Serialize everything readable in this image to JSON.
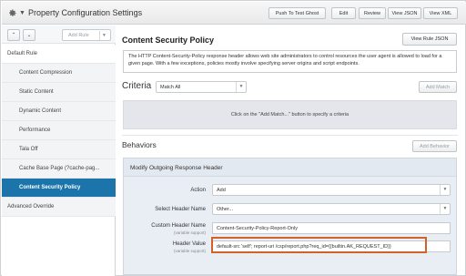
{
  "header": {
    "title": "Property Configuration Settings",
    "buttons": [
      "Push To Test Ghost",
      "Edit",
      "Review",
      "View JSON",
      "View XML"
    ]
  },
  "sidebar": {
    "add_rule_label": "Add Rule",
    "items": [
      {
        "label": "Default Rule"
      },
      {
        "label": "Content Compression"
      },
      {
        "label": "Static Content"
      },
      {
        "label": "Dynamic Content"
      },
      {
        "label": "Performance"
      },
      {
        "label": "Tala Off"
      },
      {
        "label": "Cache Base Page (?cache-pag..."
      },
      {
        "label": "Content Security Policy"
      },
      {
        "label": "Advanced Override"
      }
    ],
    "active_index": 7
  },
  "rule": {
    "title": "Content Security Policy",
    "view_json_label": "View Rule JSON",
    "description": "The HTTP Content-Security-Policy response header allows web site administrators to control resources the user agent is allowed to load for a given page. With a few exceptions, policies mostly involve specifying server origins and script endpoints."
  },
  "criteria": {
    "label": "Criteria",
    "match_value": "Match All",
    "add_match_label": "Add Match",
    "empty_text": "Click on the \"Add Match...\" button to specify a criteria"
  },
  "behaviors": {
    "label": "Behaviors",
    "add_behavior_label": "Add Behavior",
    "card_title": "Modify Outgoing Response Header",
    "fields": {
      "action": {
        "label": "Action",
        "value": "Add"
      },
      "select_header": {
        "label": "Select Header Name",
        "value": "Other..."
      },
      "custom_header": {
        "label": "Custom Header Name",
        "sublabel": "(variable support)",
        "value": "Content-Security-Policy-Report-Only"
      },
      "header_value": {
        "label": "Header Value",
        "sublabel": "(variable support)",
        "value": "default-src 'self'; report-uri /csp/report.php?req_id={{builtin.AK_REQUEST_ID}}"
      }
    }
  },
  "colors": {
    "active_item": "#1b75ab",
    "highlight_border": "#d2622a",
    "criteria_area": "#e4e6ec",
    "behavior_card": "#e9eef4"
  }
}
